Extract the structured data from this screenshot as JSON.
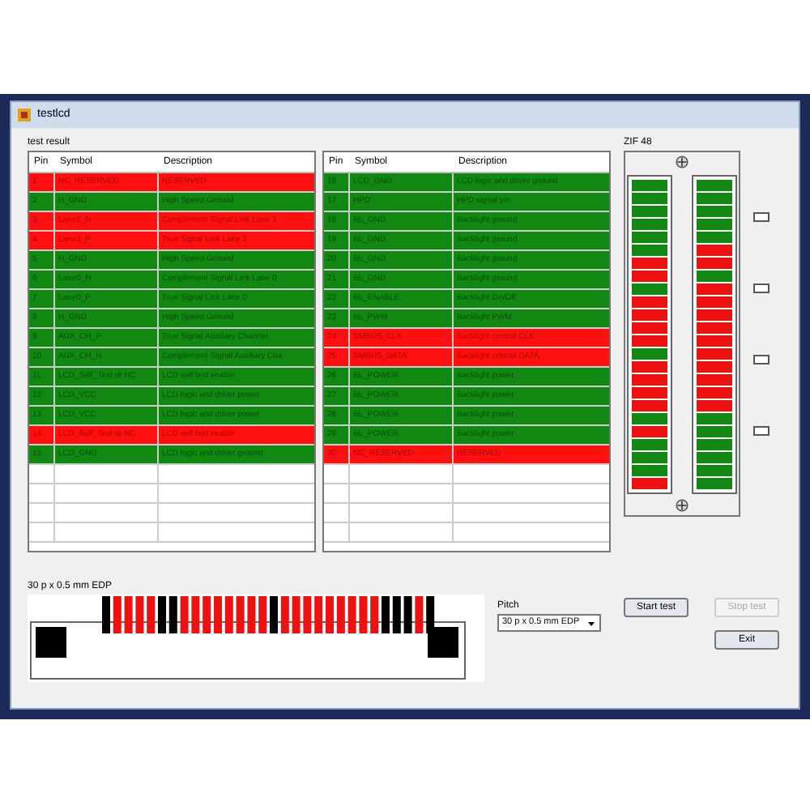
{
  "window": {
    "title": "testlcd"
  },
  "test_result": {
    "label": "test result",
    "tables": [
      {
        "columns": [
          "Pin",
          "Symbol",
          "Description"
        ],
        "rows": [
          {
            "pin": "1",
            "symbol": "NC_RESERVED",
            "description": "RESERVED",
            "pass": false
          },
          {
            "pin": "2",
            "symbol": "H_GND",
            "description": "High Speed Ground",
            "pass": true
          },
          {
            "pin": "3",
            "symbol": "Lane1_N",
            "description": "Complement Signal Link Lane 1",
            "pass": false
          },
          {
            "pin": "4",
            "symbol": "Lane1_P",
            "description": "True Signal Link Lane 1",
            "pass": false
          },
          {
            "pin": "5",
            "symbol": "H_GND",
            "description": "High Speed Ground",
            "pass": true
          },
          {
            "pin": "6",
            "symbol": "Lane0_N",
            "description": "Complement Signal Link Lane 0",
            "pass": true
          },
          {
            "pin": "7",
            "symbol": "Lane0_P",
            "description": "True Signal Link Lane 0",
            "pass": true
          },
          {
            "pin": "8",
            "symbol": "H_GND",
            "description": "High Speed Ground",
            "pass": true
          },
          {
            "pin": "9",
            "symbol": "AUX_CH_P",
            "description": "True Signal Auxiliary Channel",
            "pass": true
          },
          {
            "pin": "10",
            "symbol": "AUX_CH_N",
            "description": "Complement Signal Auxiliary Cha",
            "pass": true
          },
          {
            "pin": "11",
            "symbol": "LCD_Self_Test or NC",
            "description": "LCD self test enable",
            "pass": true
          },
          {
            "pin": "12",
            "symbol": "LCD_VCC",
            "description": "LCD logic and driver power",
            "pass": true
          },
          {
            "pin": "13",
            "symbol": "LCD_VCC",
            "description": "LCD logic and driver power",
            "pass": true
          },
          {
            "pin": "14",
            "symbol": "LCD_Self_Test or NC",
            "description": "LCD self test enable",
            "pass": false
          },
          {
            "pin": "15",
            "symbol": "LCD_GND",
            "description": "LCD logic and driver ground",
            "pass": true
          }
        ]
      },
      {
        "columns": [
          "Pin",
          "Symbol",
          "Description"
        ],
        "rows": [
          {
            "pin": "16",
            "symbol": "LCD_GND",
            "description": "LCD logic and driver ground",
            "pass": true
          },
          {
            "pin": "17",
            "symbol": "HPD",
            "description": "HPD signal pin",
            "pass": true
          },
          {
            "pin": "18",
            "symbol": "BL_GND",
            "description": "Backlight ground",
            "pass": true
          },
          {
            "pin": "19",
            "symbol": "BL_GND",
            "description": "Backlight ground",
            "pass": true
          },
          {
            "pin": "20",
            "symbol": "BL_GND",
            "description": "Backlight ground",
            "pass": true
          },
          {
            "pin": "21",
            "symbol": "BL_GND",
            "description": "Backlight ground",
            "pass": true
          },
          {
            "pin": "22",
            "symbol": "BL_ENABLE",
            "description": "Backlight On/Off",
            "pass": true
          },
          {
            "pin": "23",
            "symbol": "BL_PWM",
            "description": "Backlight PWM",
            "pass": true
          },
          {
            "pin": "24",
            "symbol": "SMBUS_CLK",
            "description": "Backlight control CLK",
            "pass": false
          },
          {
            "pin": "25",
            "symbol": "SMBUS_DATA",
            "description": "Backlight control DATA",
            "pass": false
          },
          {
            "pin": "26",
            "symbol": "BL_POWER",
            "description": "Backlight power",
            "pass": true
          },
          {
            "pin": "27",
            "symbol": "BL_POWER",
            "description": "Backlight power",
            "pass": true
          },
          {
            "pin": "28",
            "symbol": "BL_POWER",
            "description": "Backlight power",
            "pass": true
          },
          {
            "pin": "29",
            "symbol": "BL_POWER",
            "description": "Backlight power",
            "pass": true
          },
          {
            "pin": "30",
            "symbol": "NC_RESERVED",
            "description": "RESERVED",
            "pass": false
          }
        ]
      }
    ]
  },
  "zif": {
    "label": "ZIF 48",
    "columns": [
      {
        "contacts": [
          {
            "color": "#118811"
          },
          {
            "color": "#118811"
          },
          {
            "color": "#118811"
          },
          {
            "color": "#118811"
          },
          {
            "color": "#118811"
          },
          {
            "color": "#118811"
          },
          {
            "color": "#ee1111"
          },
          {
            "color": "#ee1111"
          },
          {
            "color": "#118811"
          },
          {
            "color": "#ee1111"
          },
          {
            "color": "#ee1111"
          },
          {
            "color": "#ee1111"
          },
          {
            "color": "#ee1111"
          },
          {
            "color": "#118811"
          },
          {
            "color": "#ee1111"
          },
          {
            "color": "#ee1111"
          },
          {
            "color": "#ee1111"
          },
          {
            "color": "#ee1111"
          },
          {
            "color": "#118811"
          },
          {
            "color": "#ee1111"
          },
          {
            "color": "#118811"
          },
          {
            "color": "#118811"
          },
          {
            "color": "#118811"
          },
          {
            "color": "#ee1111"
          }
        ]
      },
      {
        "contacts": [
          {
            "color": "#118811"
          },
          {
            "color": "#118811"
          },
          {
            "color": "#118811"
          },
          {
            "color": "#118811"
          },
          {
            "color": "#118811"
          },
          {
            "color": "#ee1111"
          },
          {
            "color": "#ee1111"
          },
          {
            "color": "#118811"
          },
          {
            "color": "#ee1111"
          },
          {
            "color": "#ee1111"
          },
          {
            "color": "#ee1111"
          },
          {
            "color": "#ee1111"
          },
          {
            "color": "#ee1111"
          },
          {
            "color": "#ee1111"
          },
          {
            "color": "#ee1111"
          },
          {
            "color": "#ee1111"
          },
          {
            "color": "#ee1111"
          },
          {
            "color": "#ee1111"
          },
          {
            "color": "#118811"
          },
          {
            "color": "#118811"
          },
          {
            "color": "#118811"
          },
          {
            "color": "#118811"
          },
          {
            "color": "#118811"
          },
          {
            "color": "#118811"
          }
        ]
      }
    ]
  },
  "connector": {
    "label": "30 p x 0.5 mm EDP",
    "pins": [
      {
        "color": "#000000"
      },
      {
        "color": "#ee1111"
      },
      {
        "color": "#ee1111"
      },
      {
        "color": "#ee1111"
      },
      {
        "color": "#ee1111"
      },
      {
        "color": "#000000"
      },
      {
        "color": "#000000"
      },
      {
        "color": "#ee1111"
      },
      {
        "color": "#ee1111"
      },
      {
        "color": "#ee1111"
      },
      {
        "color": "#ee1111"
      },
      {
        "color": "#ee1111"
      },
      {
        "color": "#ee1111"
      },
      {
        "color": "#ee1111"
      },
      {
        "color": "#ee1111"
      },
      {
        "color": "#000000"
      },
      {
        "color": "#ee1111"
      },
      {
        "color": "#ee1111"
      },
      {
        "color": "#ee1111"
      },
      {
        "color": "#ee1111"
      },
      {
        "color": "#ee1111"
      },
      {
        "color": "#ee1111"
      },
      {
        "color": "#ee1111"
      },
      {
        "color": "#ee1111"
      },
      {
        "color": "#ee1111"
      },
      {
        "color": "#000000"
      },
      {
        "color": "#000000"
      },
      {
        "color": "#000000"
      },
      {
        "color": "#ee1111"
      },
      {
        "color": "#000000"
      }
    ]
  },
  "pitch": {
    "label": "Pitch",
    "value": "30 p x 0.5 mm EDP"
  },
  "buttons": [
    {
      "label": "Start test",
      "disabled": false
    },
    {
      "label": "Stop test",
      "disabled": true
    },
    {
      "label": "Exit",
      "disabled": false
    }
  ]
}
